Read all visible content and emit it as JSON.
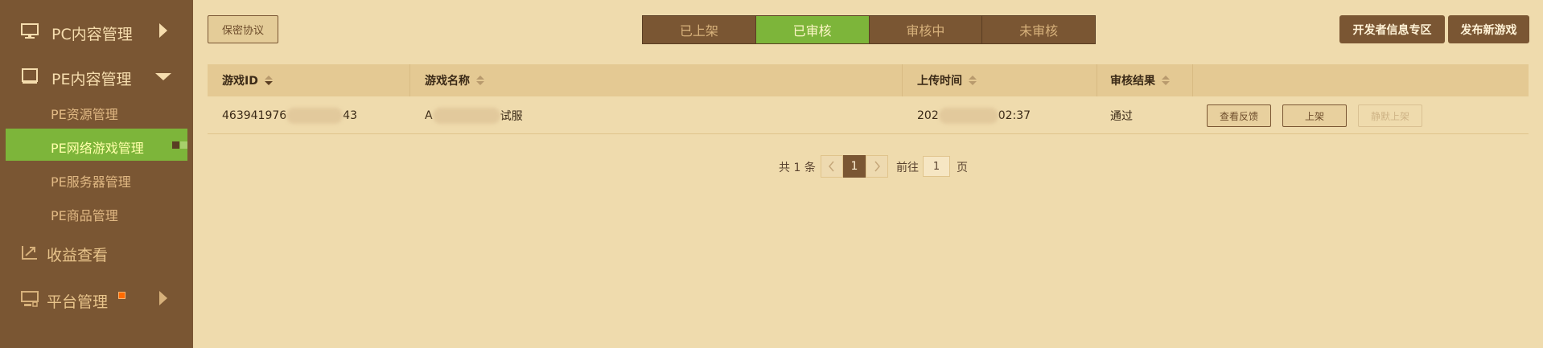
{
  "sidebar": {
    "pc": {
      "label": "PC内容管理",
      "icon": "monitor-icon"
    },
    "pe": {
      "label": "PE内容管理",
      "icon": "tablet-icon",
      "items": [
        {
          "label": "PE资源管理"
        },
        {
          "label": "PE网络游戏管理",
          "active": true
        },
        {
          "label": "PE服务器管理"
        },
        {
          "label": "PE商品管理"
        }
      ]
    },
    "earnings": {
      "label": "收益查看",
      "icon": "chart-up-icon"
    },
    "platform": {
      "label": "平台管理",
      "icon": "platform-monitor-icon"
    }
  },
  "toolbar": {
    "nda_label": "保密协议",
    "dev_info_label": "开发者信息专区",
    "publish_label": "发布新游戏"
  },
  "tabs": [
    {
      "label": "已上架",
      "active": false
    },
    {
      "label": "已审核",
      "active": true
    },
    {
      "label": "审核中",
      "active": false
    },
    {
      "label": "未审核",
      "active": false
    }
  ],
  "table": {
    "headers": [
      "游戏ID",
      "游戏名称",
      "上传时间",
      "审核结果"
    ],
    "rows": [
      {
        "id_prefix": "463941976",
        "id_suffix": "43",
        "name_prefix": "A",
        "name_suffix": "试服",
        "time_prefix": "202",
        "time_suffix": "02:37",
        "result": "通过",
        "actions": {
          "feedback": "查看反馈",
          "shelve": "上架",
          "default_shelve": "静默上架"
        }
      }
    ]
  },
  "pagination": {
    "total_prefix": "共",
    "total": "1",
    "total_suffix": "条",
    "current": "1",
    "goto_label": "前往",
    "goto_value": "1",
    "page_label": "页"
  },
  "colors": {
    "sidebar_bg": "#7a5633",
    "accent_green": "#7db53a",
    "content_bg": "#efdbad"
  }
}
